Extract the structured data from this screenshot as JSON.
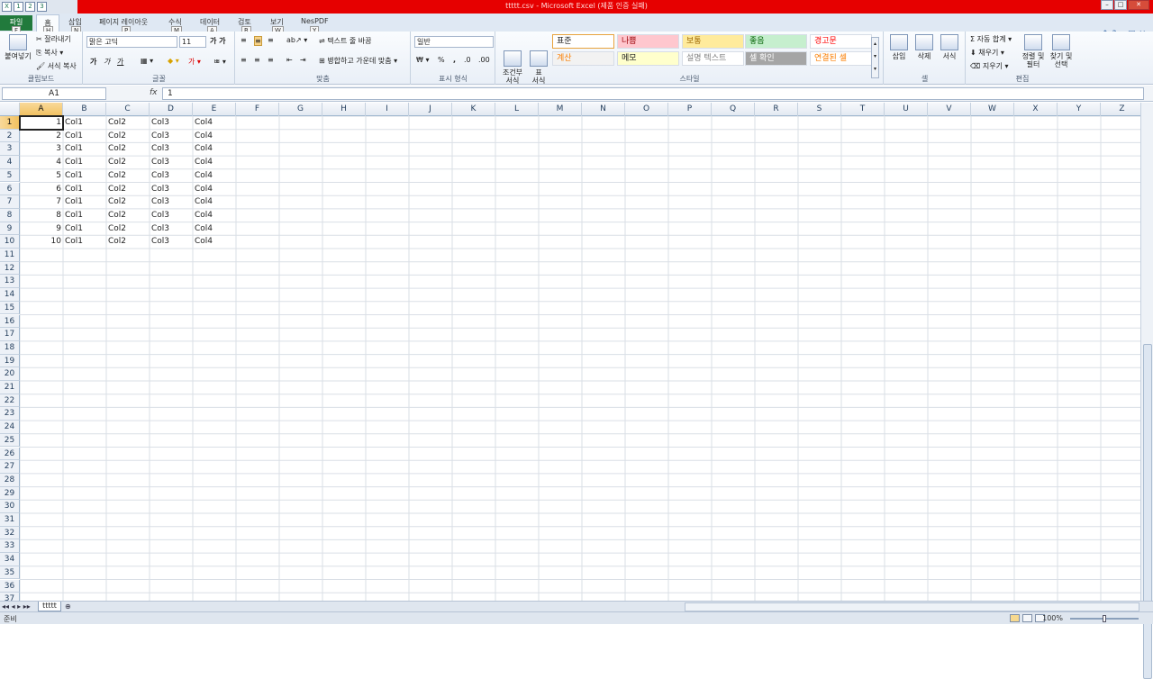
{
  "window": {
    "title": "ttttt.csv  -  Microsoft Excel (제품 인증 실패)",
    "min": "–",
    "max": "□",
    "close": "✕"
  },
  "qat": {
    "keytips": [
      "1",
      "2",
      "3"
    ]
  },
  "tabs": [
    {
      "label": "파일",
      "key": "F"
    },
    {
      "label": "홈",
      "key": "H"
    },
    {
      "label": "삽입",
      "key": "N"
    },
    {
      "label": "페이지 레이아웃",
      "key": "P"
    },
    {
      "label": "수식",
      "key": "M"
    },
    {
      "label": "데이터",
      "key": "A"
    },
    {
      "label": "검토",
      "key": "R"
    },
    {
      "label": "보기",
      "key": "W"
    },
    {
      "label": "NesPDF",
      "key": "Y"
    }
  ],
  "ribbon": {
    "clipboard": {
      "paste": "붙여넣기",
      "cut": "잘라내기",
      "copy": "복사",
      "format_painter": "서식 복사",
      "label": "클립보드"
    },
    "font": {
      "name": "맑은 고딕",
      "size": "11",
      "bold": "가",
      "italic": "가",
      "underline": "가",
      "label": "글꼴"
    },
    "alignment": {
      "wrap": "텍스트 줄 바꿈",
      "merge": "병합하고 가운데 맞춤",
      "label": "맞춤"
    },
    "number": {
      "format": "일반",
      "percent": "%",
      "comma": ",",
      "label": "표시 형식"
    },
    "styles": {
      "conditional": "조건부\n서식",
      "table": "표\n서식",
      "cells": [
        {
          "label": "표준",
          "bg": "#ffffff",
          "fg": "#222222"
        },
        {
          "label": "나쁨",
          "bg": "#ffc7ce",
          "fg": "#9c0006"
        },
        {
          "label": "보통",
          "bg": "#ffeb9c",
          "fg": "#9c6500"
        },
        {
          "label": "좋음",
          "bg": "#c6efce",
          "fg": "#006100"
        },
        {
          "label": "경고문",
          "bg": "#ffffff",
          "fg": "#ff0000"
        },
        {
          "label": "계산",
          "bg": "#f2f2f2",
          "fg": "#fa7d00"
        },
        {
          "label": "메모",
          "bg": "#ffffcc",
          "fg": "#222222"
        },
        {
          "label": "설명 텍스트",
          "bg": "#ffffff",
          "fg": "#7f7f7f"
        },
        {
          "label": "셀 확인",
          "bg": "#a5a5a5",
          "fg": "#ffffff"
        },
        {
          "label": "연결된 셀",
          "bg": "#ffffff",
          "fg": "#fa7d00"
        }
      ],
      "label": "스타일"
    },
    "cells": {
      "insert": "삽입",
      "delete": "삭제",
      "format": "서식",
      "label": "셀"
    },
    "editing": {
      "autosum": "자동 합계",
      "fill": "채우기",
      "clear": "지우기",
      "sort": "정렬 및\n필터",
      "find": "찾기 및\n선택",
      "label": "편집"
    }
  },
  "formula_bar": {
    "name_box": "A1",
    "fx": "fx",
    "value": "1"
  },
  "columns": [
    "A",
    "B",
    "C",
    "D",
    "E",
    "F",
    "G",
    "H",
    "I",
    "J",
    "K",
    "L",
    "M",
    "N",
    "O",
    "P",
    "Q",
    "R",
    "S",
    "T",
    "U",
    "V",
    "W",
    "X",
    "Y",
    "Z"
  ],
  "row_count": 37,
  "rows": [
    [
      "1",
      "Col1",
      "Col2",
      "Col3",
      "Col4"
    ],
    [
      "2",
      "Col1",
      "Col2",
      "Col3",
      "Col4"
    ],
    [
      "3",
      "Col1",
      "Col2",
      "Col3",
      "Col4"
    ],
    [
      "4",
      "Col1",
      "Col2",
      "Col3",
      "Col4"
    ],
    [
      "5",
      "Col1",
      "Col2",
      "Col3",
      "Col4"
    ],
    [
      "6",
      "Col1",
      "Col2",
      "Col3",
      "Col4"
    ],
    [
      "7",
      "Col1",
      "Col2",
      "Col3",
      "Col4"
    ],
    [
      "8",
      "Col1",
      "Col2",
      "Col3",
      "Col4"
    ],
    [
      "9",
      "Col1",
      "Col2",
      "Col3",
      "Col4"
    ],
    [
      "10",
      "Col1",
      "Col2",
      "Col3",
      "Col4"
    ]
  ],
  "sheets": [
    "ttttt"
  ],
  "status": {
    "ready": "준비",
    "zoom": "100%"
  }
}
